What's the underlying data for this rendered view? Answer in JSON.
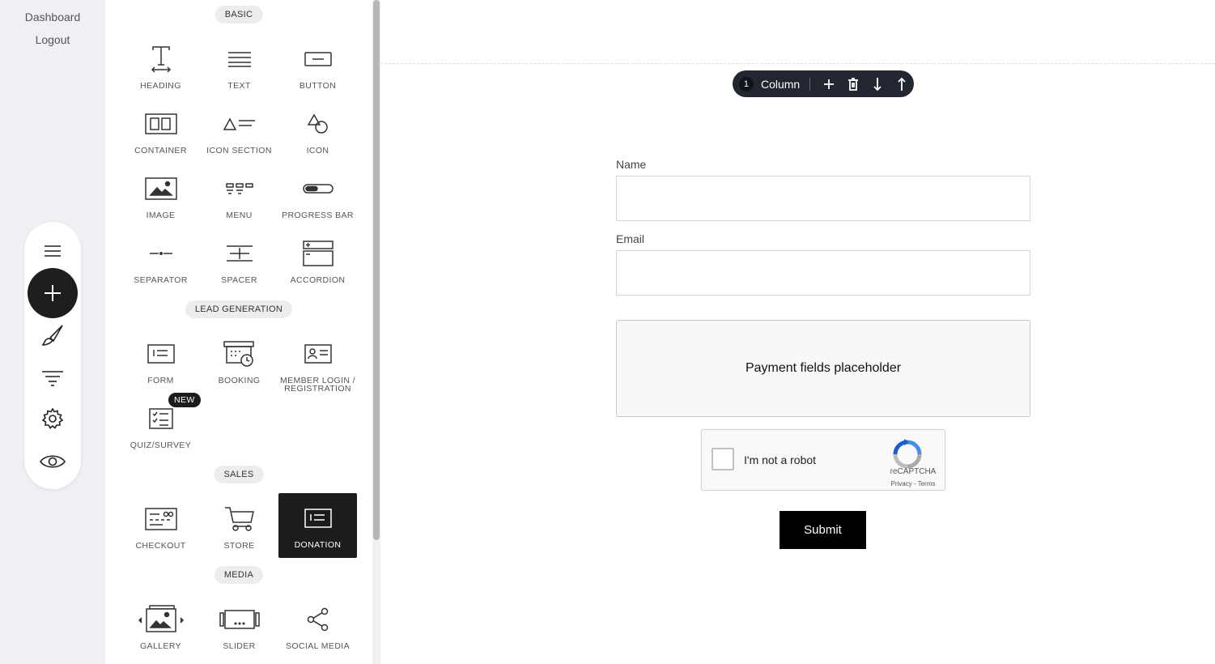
{
  "rail": {
    "links": [
      "Dashboard",
      "Logout"
    ],
    "tools": [
      "menu-icon",
      "add-icon",
      "brush-icon",
      "filter-icon",
      "gear-icon",
      "eye-icon"
    ]
  },
  "panel": {
    "sections": {
      "basic": "BASIC",
      "lead": "LEAD GENERATION",
      "sales": "SALES",
      "media": "MEDIA"
    },
    "elements": {
      "heading": "HEADING",
      "text": "TEXT",
      "button": "BUTTON",
      "container": "CONTAINER",
      "icon_section": "ICON SECTION",
      "icon": "ICON",
      "image": "IMAGE",
      "menu": "MENU",
      "progress_bar": "PROGRESS BAR",
      "separator": "SEPARATOR",
      "spacer": "SPACER",
      "accordion": "ACCORDION",
      "form": "FORM",
      "booking": "BOOKING",
      "member_login_1": "MEMBER LOGIN /",
      "member_login_2": "REGISTRATION",
      "quiz": "QUIZ/SURVEY",
      "checkout": "CHECKOUT",
      "store": "STORE",
      "donation": "DONATION",
      "gallery": "GALLERY",
      "slider": "SLIDER",
      "social_media": "SOCIAL MEDIA"
    },
    "badge_new": "NEW",
    "selected": "donation"
  },
  "canvas": {
    "column_toolbar": {
      "number": "1",
      "label": "Column"
    },
    "form": {
      "name_label": "Name",
      "email_label": "Email",
      "name_value": "",
      "email_value": "",
      "payment_placeholder": "Payment fields placeholder",
      "captcha_text": "I'm not a robot",
      "captcha_brand": "reCAPTCHA",
      "captcha_links": "Privacy - Terms",
      "submit_label": "Submit"
    }
  },
  "colors": {
    "rail_bg": "#eef0f3",
    "toolbar_bg": "#222631",
    "selected_bg": "#1c1c1c",
    "submit_bg": "#000000"
  }
}
